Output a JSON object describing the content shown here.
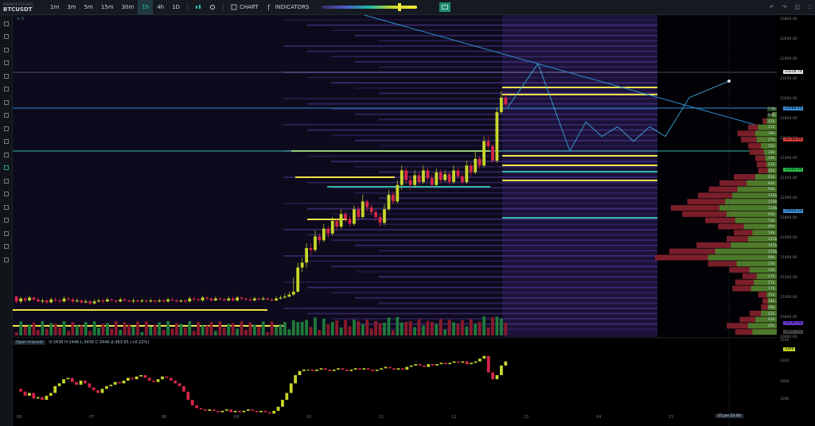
{
  "header": {
    "exchange": "BINANCE FUTURES",
    "symbol": "BTCUSDT",
    "timeframes": [
      {
        "label": "1m",
        "active": false
      },
      {
        "label": "3m",
        "active": false
      },
      {
        "label": "5m",
        "active": false
      },
      {
        "label": "15m",
        "active": false
      },
      {
        "label": "30m",
        "active": false
      },
      {
        "label": "1h",
        "active": true
      },
      {
        "label": "4h",
        "active": false
      },
      {
        "label": "1D",
        "active": false
      }
    ],
    "chart_label": "CHART",
    "indicators_label": "INDICATORS",
    "heatmap_slider_level": 0.8
  },
  "watermark": "≡ 0",
  "left_toolbar_icons": [
    "crosshair-icon",
    "cursor-icon",
    "eye-icon",
    "brush-icon",
    "eraser-icon",
    "trash-icon",
    "trendline-icon",
    "path-icon",
    "flag-icon",
    "ruler-icon",
    "horizontal-ray-icon",
    "pencil-icon",
    "rectangle-icon",
    "fib-icon",
    "grid-icon",
    "vertical-line-icon",
    "parallel-channel-icon",
    "text-icon",
    "pattern-icon"
  ],
  "oi_stats": {
    "label": "Open Interest",
    "values": "O:3436  H:3446  L:3436  C:3446  Δ:383.65 (+0.22%)"
  },
  "price_axis_ticks": [
    "23800.00",
    "23600.00",
    "23400.00",
    "23200.00",
    "23000.00",
    "22800.00",
    "22600.00",
    "22400.00",
    "22200.00",
    "22000.00",
    "21800.00",
    "21600.00",
    "21400.00",
    "21200.00",
    "21000.00",
    "20800.00",
    "20600.00"
  ],
  "price_tags": [
    {
      "label": "23218.74",
      "color": "#e6e6e6"
    },
    {
      "label": "22988.00",
      "color": "#3a8fd6"
    },
    {
      "label": "22788.00",
      "color": "#d63a3a"
    },
    {
      "label": "22500.00",
      "color": "#27c24c"
    },
    {
      "label": "21926.25",
      "color": "#3a8fd6"
    },
    {
      "label": "20785.93",
      "color": "#6a3ad6"
    },
    {
      "label": "20657.53",
      "color": "#444444"
    }
  ],
  "volume_profile_labels": [
    "7.6k",
    "5.9k",
    "41k",
    "37k",
    "36k",
    "27k",
    "22k",
    "23k",
    "19k",
    "21k",
    "42k",
    "62k",
    "81k",
    "92k",
    "112k",
    "150k",
    "134k",
    "93k",
    "73k",
    "46k",
    "54k",
    "111k",
    "141k",
    "175k",
    "90k",
    "53k",
    "33k",
    "47k",
    "57k",
    "17k",
    "11k",
    "14k",
    "29k",
    "41k",
    "62k",
    "45k"
  ],
  "oi_axis_ticks": [
    "3340",
    "3320",
    "3300",
    "3280"
  ],
  "oi_current": "3346",
  "x_axis_ticks": [
    "06",
    "07",
    "08",
    "09",
    "10",
    "11",
    "12",
    "13",
    "14",
    "15"
  ],
  "cursor_time_label": "15 Jan  22:00",
  "chart_data": {
    "type": "candlestick",
    "title": "",
    "xlabel": "",
    "ylabel": "",
    "ylim": [
      20600,
      23900
    ],
    "candles": [
      [
        21000,
        20950,
        21010,
        20930
      ],
      [
        20950,
        20980,
        21000,
        20930
      ],
      [
        20980,
        20960,
        21000,
        20940
      ],
      [
        20960,
        20990,
        21010,
        20950
      ],
      [
        20990,
        20970,
        21000,
        20950
      ],
      [
        20970,
        20950,
        20990,
        20940
      ],
      [
        20950,
        20960,
        20980,
        20930
      ],
      [
        20960,
        20940,
        20970,
        20920
      ],
      [
        20940,
        20970,
        20990,
        20930
      ],
      [
        20970,
        20960,
        20990,
        20940
      ],
      [
        20960,
        20950,
        20980,
        20930
      ],
      [
        20950,
        20980,
        21000,
        20940
      ],
      [
        20980,
        20970,
        21000,
        20950
      ],
      [
        20970,
        20950,
        20990,
        20930
      ],
      [
        20950,
        20960,
        20980,
        20940
      ],
      [
        20960,
        20940,
        20970,
        20920
      ],
      [
        20940,
        20950,
        20970,
        20930
      ],
      [
        20950,
        20930,
        20960,
        20910
      ],
      [
        20930,
        20950,
        20970,
        20920
      ],
      [
        20950,
        20960,
        20980,
        20940
      ],
      [
        20960,
        20950,
        20980,
        20930
      ],
      [
        20950,
        20970,
        20990,
        20940
      ],
      [
        20970,
        20960,
        20980,
        20950
      ],
      [
        20960,
        20950,
        20970,
        20930
      ],
      [
        20950,
        20970,
        20990,
        20940
      ],
      [
        20970,
        20960,
        20990,
        20950
      ],
      [
        20960,
        20950,
        20970,
        20940
      ],
      [
        20950,
        20960,
        20980,
        20930
      ],
      [
        20960,
        20950,
        20970,
        20940
      ],
      [
        20950,
        20960,
        20980,
        20940
      ],
      [
        20960,
        20950,
        20970,
        20940
      ],
      [
        20950,
        20960,
        20980,
        20940
      ],
      [
        20960,
        20950,
        20970,
        20930
      ],
      [
        20950,
        20960,
        20980,
        20940
      ],
      [
        20960,
        20950,
        20980,
        20940
      ],
      [
        20950,
        20970,
        20990,
        20940
      ],
      [
        20970,
        20960,
        20990,
        20950
      ],
      [
        20960,
        20950,
        20980,
        20940
      ],
      [
        20950,
        20960,
        20970,
        20940
      ],
      [
        20960,
        20950,
        20970,
        20930
      ],
      [
        20950,
        20980,
        21000,
        20940
      ],
      [
        20980,
        20970,
        21000,
        20950
      ],
      [
        20970,
        20960,
        20990,
        20950
      ],
      [
        20960,
        20990,
        21010,
        20950
      ],
      [
        20990,
        20980,
        21000,
        20960
      ],
      [
        20980,
        20960,
        20990,
        20950
      ],
      [
        20960,
        20980,
        21000,
        20950
      ],
      [
        20980,
        20970,
        20990,
        20960
      ],
      [
        20970,
        20960,
        20990,
        20950
      ],
      [
        20960,
        20980,
        21000,
        20950
      ],
      [
        20980,
        20960,
        21000,
        20950
      ],
      [
        20960,
        20990,
        21010,
        20950
      ],
      [
        20990,
        20980,
        21000,
        20960
      ],
      [
        20980,
        20970,
        20990,
        20960
      ],
      [
        20970,
        20960,
        20990,
        20950
      ],
      [
        20960,
        20980,
        21000,
        20950
      ],
      [
        20980,
        20970,
        20990,
        20960
      ],
      [
        20970,
        20980,
        21000,
        20960
      ],
      [
        20980,
        20970,
        20990,
        20960
      ],
      [
        20970,
        20960,
        20980,
        20950
      ],
      [
        20960,
        20980,
        21000,
        20950
      ],
      [
        20980,
        20990,
        21010,
        20970
      ],
      [
        20990,
        21000,
        21030,
        20980
      ],
      [
        21000,
        21020,
        21050,
        20990
      ],
      [
        21020,
        21050,
        21200,
        21010
      ],
      [
        21050,
        21300,
        21350,
        21040
      ],
      [
        21300,
        21350,
        21400,
        21250
      ],
      [
        21350,
        21500,
        21550,
        21300
      ],
      [
        21500,
        21480,
        21550,
        21430
      ],
      [
        21480,
        21620,
        21680,
        21460
      ],
      [
        21620,
        21580,
        21650,
        21540
      ],
      [
        21580,
        21700,
        21750,
        21560
      ],
      [
        21700,
        21650,
        21730,
        21600
      ],
      [
        21650,
        21780,
        21820,
        21630
      ],
      [
        21780,
        21720,
        21800,
        21680
      ],
      [
        21720,
        21850,
        21900,
        21700
      ],
      [
        21850,
        21800,
        21880,
        21760
      ],
      [
        21800,
        21750,
        21830,
        21720
      ],
      [
        21750,
        21900,
        21940,
        21730
      ],
      [
        21900,
        21820,
        21930,
        21780
      ],
      [
        21820,
        21980,
        22050,
        21800
      ],
      [
        21980,
        21920,
        22000,
        21880
      ],
      [
        21920,
        21870,
        21950,
        21840
      ],
      [
        21870,
        21820,
        21900,
        21780
      ],
      [
        21820,
        21760,
        21850,
        21720
      ],
      [
        21760,
        21900,
        21950,
        21740
      ],
      [
        21900,
        22050,
        22100,
        21880
      ],
      [
        22050,
        21980,
        22080,
        21950
      ],
      [
        21980,
        22150,
        22200,
        21960
      ],
      [
        22150,
        22300,
        22350,
        22100
      ],
      [
        22300,
        22200,
        22330,
        22160
      ],
      [
        22200,
        22150,
        22250,
        22100
      ],
      [
        22150,
        22250,
        22300,
        22120
      ],
      [
        22250,
        22180,
        22280,
        22140
      ],
      [
        22180,
        22300,
        22350,
        22160
      ],
      [
        22300,
        22220,
        22330,
        22180
      ],
      [
        22220,
        22150,
        22260,
        22120
      ],
      [
        22150,
        22280,
        22320,
        22130
      ],
      [
        22280,
        22200,
        22310,
        22170
      ],
      [
        22200,
        22260,
        22300,
        22180
      ],
      [
        22260,
        22180,
        22290,
        22150
      ],
      [
        22180,
        22300,
        22350,
        22160
      ],
      [
        22300,
        22240,
        22330,
        22210
      ],
      [
        22240,
        22180,
        22270,
        22150
      ],
      [
        22180,
        22350,
        22400,
        22160
      ],
      [
        22350,
        22280,
        22380,
        22240
      ],
      [
        22280,
        22420,
        22500,
        22260
      ],
      [
        22420,
        22350,
        22450,
        22320
      ],
      [
        22350,
        22600,
        22650,
        22330
      ],
      [
        22600,
        22550,
        22650,
        22500
      ],
      [
        22550,
        22400,
        22580,
        22380
      ],
      [
        22400,
        22900,
        22950,
        22380
      ],
      [
        22900,
        23050,
        23120,
        22880
      ],
      [
        23050,
        22980,
        23100,
        22950
      ]
    ],
    "volume_profile_bars": [
      [
        7,
        6
      ],
      [
        20,
        14
      ],
      [
        40,
        26
      ],
      [
        55,
        30
      ],
      [
        50,
        28
      ],
      [
        40,
        22
      ],
      [
        38,
        18
      ],
      [
        30,
        16
      ],
      [
        28,
        14
      ],
      [
        26,
        12
      ],
      [
        60,
        30
      ],
      [
        80,
        42
      ],
      [
        95,
        55
      ],
      [
        110,
        62
      ],
      [
        125,
        72
      ],
      [
        148,
        80
      ],
      [
        132,
        70
      ],
      [
        100,
        58
      ],
      [
        82,
        46
      ],
      [
        60,
        34
      ],
      [
        70,
        40
      ],
      [
        112,
        64
      ],
      [
        150,
        86
      ],
      [
        170,
        96
      ],
      [
        96,
        56
      ],
      [
        66,
        38
      ],
      [
        48,
        28
      ],
      [
        58,
        32
      ],
      [
        62,
        36
      ],
      [
        26,
        14
      ],
      [
        20,
        12
      ],
      [
        22,
        12
      ],
      [
        38,
        22
      ],
      [
        52,
        30
      ],
      [
        70,
        40
      ],
      [
        58,
        34
      ]
    ],
    "oi_series": [
      3308,
      3306,
      3303,
      3305,
      3301,
      3302,
      3300,
      3303,
      3305,
      3310,
      3312,
      3315,
      3316,
      3313,
      3311,
      3314,
      3312,
      3309,
      3307,
      3305,
      3308,
      3310,
      3311,
      3313,
      3312,
      3314,
      3316,
      3315,
      3317,
      3318,
      3316,
      3314,
      3313,
      3315,
      3317,
      3316,
      3314,
      3312,
      3310,
      3306,
      3300,
      3296,
      3294,
      3293,
      3292,
      3293,
      3292,
      3291,
      3292,
      3293,
      3291,
      3292,
      3291,
      3292,
      3293,
      3292,
      3291,
      3292,
      3291,
      3290,
      3292,
      3295,
      3300,
      3305,
      3312,
      3318,
      3321,
      3322,
      3322,
      3321,
      3322,
      3323,
      3322,
      3321,
      3322,
      3323,
      3322,
      3321,
      3322,
      3323,
      3322,
      3323,
      3322,
      3321,
      3322,
      3323,
      3324,
      3323,
      3322,
      3323,
      3322,
      3324,
      3325,
      3326,
      3325,
      3324,
      3326,
      3325,
      3326,
      3327,
      3326,
      3327,
      3328,
      3327,
      3328,
      3326,
      3327,
      3328,
      3330,
      3332,
      3320,
      3315,
      3318,
      3325,
      3328
    ],
    "trend_line": {
      "x": [
        0,
        1.04
      ],
      "y": [
        23900,
        23070
      ]
    },
    "forecast_path": [
      [
        22950,
        22500
      ],
      [
        23400,
        23050
      ],
      [
        22600,
        22450
      ],
      [
        22750,
        22650
      ],
      [
        22600,
        22700
      ],
      [
        22800,
        23100
      ],
      [
        23220,
        23220
      ]
    ]
  }
}
